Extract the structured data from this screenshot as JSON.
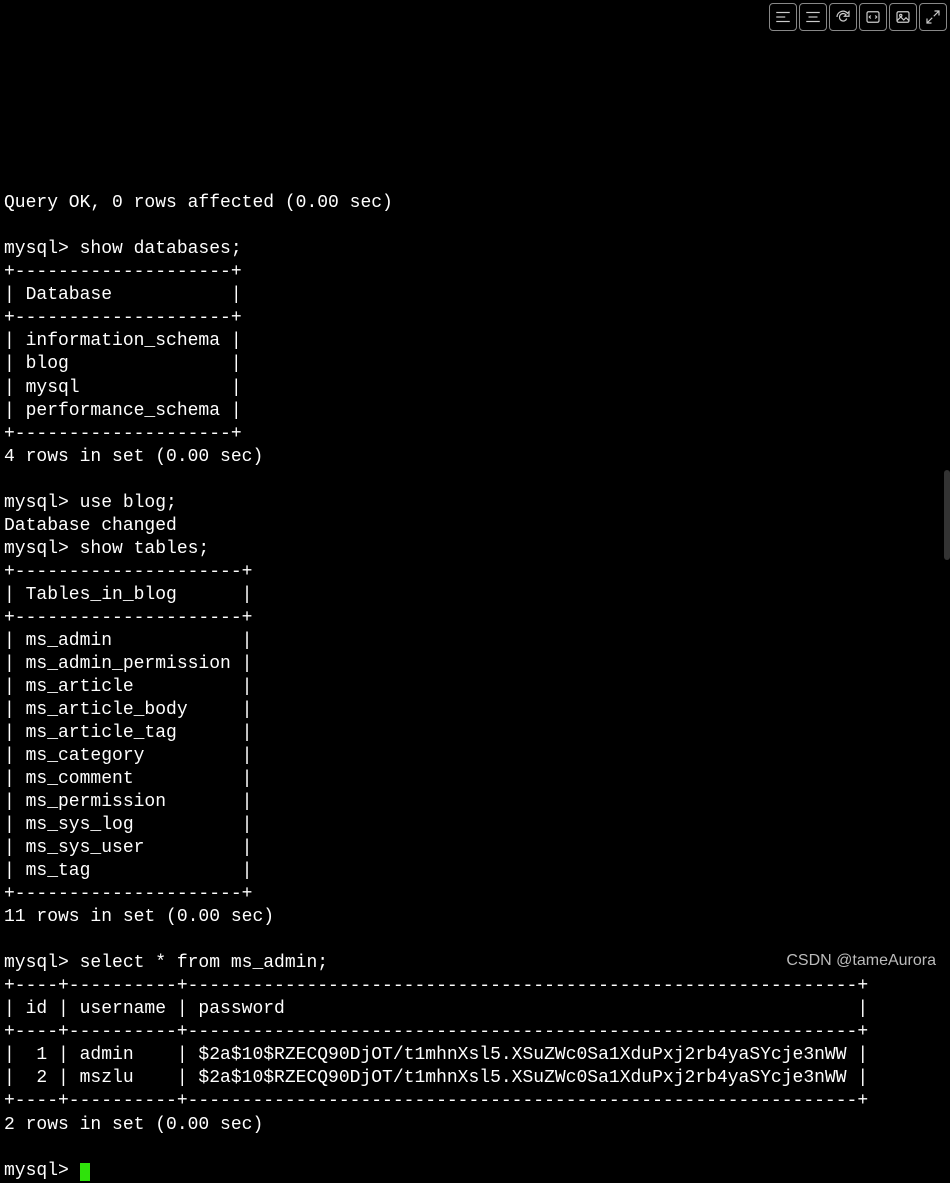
{
  "toolbar_icons": [
    "left-align",
    "center-align",
    "refresh",
    "code",
    "image",
    "fullscreen"
  ],
  "lines": {
    "query_ok": "Query OK, 0 rows affected (0.00 sec)",
    "prompt_show_db": "mysql> show databases;",
    "db_border": "+--------------------+",
    "db_header": "| Database           |",
    "db_rows": [
      "| information_schema |",
      "| blog               |",
      "| mysql              |",
      "| performance_schema |"
    ],
    "db_footer": "4 rows in set (0.00 sec)",
    "prompt_use_blog": "mysql> use blog;",
    "db_changed": "Database changed",
    "prompt_show_tables": "mysql> show tables;",
    "tbl_border": "+---------------------+",
    "tbl_header": "| Tables_in_blog      |",
    "tbl_rows": [
      "| ms_admin            |",
      "| ms_admin_permission |",
      "| ms_article          |",
      "| ms_article_body     |",
      "| ms_article_tag      |",
      "| ms_category         |",
      "| ms_comment          |",
      "| ms_permission       |",
      "| ms_sys_log          |",
      "| ms_sys_user         |",
      "| ms_tag              |"
    ],
    "tbl_footer": "11 rows in set (0.00 sec)",
    "prompt_select": "mysql> select * from ms_admin;",
    "adm_border": "+----+----------+--------------------------------------------------------------+",
    "adm_header": "| id | username | password                                                     |",
    "adm_rows": [
      "|  1 | admin    | $2a$10$RZECQ90DjOT/t1mhnXsl5.XSuZWc0Sa1XduPxj2rb4yaSYcje3nWW |",
      "|  2 | mszlu    | $2a$10$RZECQ90DjOT/t1mhnXsl5.XSuZWc0Sa1XduPxj2rb4yaSYcje3nWW |"
    ],
    "adm_footer": "2 rows in set (0.00 sec)",
    "prompt_final": "mysql> "
  },
  "watermark": "CSDN @tameAurora"
}
